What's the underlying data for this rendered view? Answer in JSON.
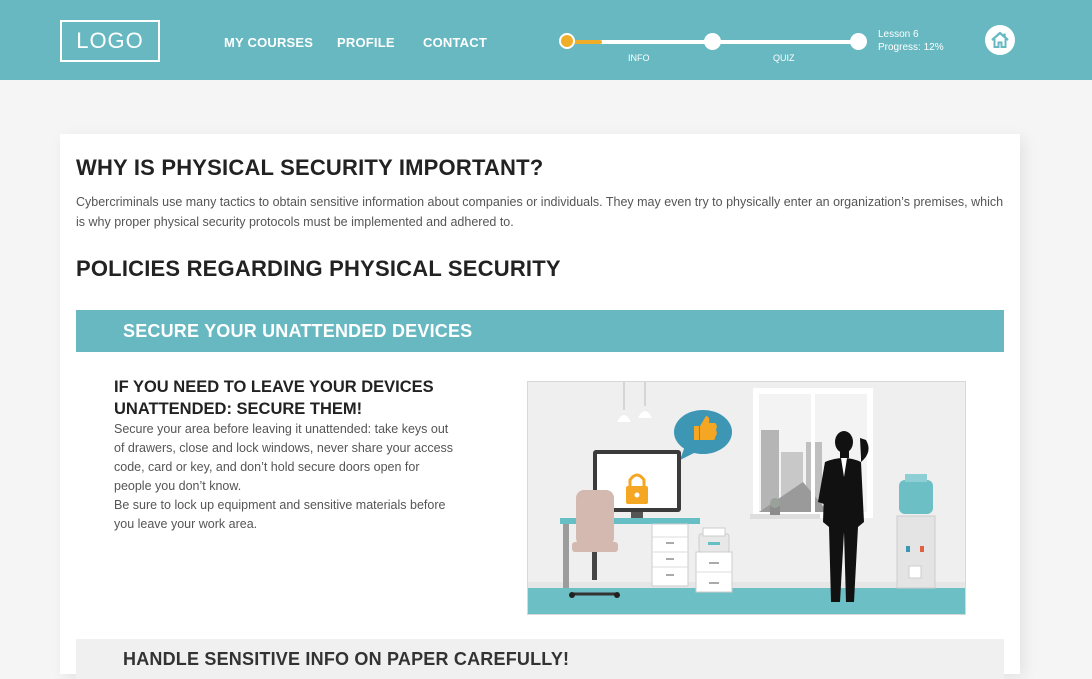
{
  "header": {
    "logo": "LOGO",
    "nav": [
      "MY COURSES",
      "PROFILE",
      "CONTACT"
    ],
    "progress": {
      "fraction": 0.12,
      "labels": [
        "INFO",
        "QUIZ"
      ],
      "lesson": "Lesson 6",
      "progress_text": "Progress: 12%"
    },
    "home_icon": "home-icon"
  },
  "content": {
    "title1": "WHY IS PHYSICAL SECURITY IMPORTANT?",
    "intro": "Cybercriminals use many tactics to obtain sensitive information about companies or individuals. They may even try to physically enter an organization’s premises, which is why proper physical security protocols must be implemented and adhered to.",
    "title2": "POLICIES REGARDING PHYSICAL SECURITY",
    "section1": {
      "banner": "SECURE YOUR UNATTENDED DEVICES",
      "heading": "IF YOU NEED TO LEAVE YOUR DEVICES UNATTENDED: SECURE THEM!",
      "paragraphs": [
        "Secure your area before leaving it unattended: take keys out of drawers, close and lock windows, never share your access code, card or key, and don’t hold secure doors open for people you don’t know.",
        "Be sure to lock up equipment and sensitive materials before you leave your work area."
      ]
    },
    "section2": {
      "banner": "HANDLE SENSITIVE INFO ON PAPER CAREFULLY!"
    }
  },
  "colors": {
    "accent": "#67b8c1",
    "progress": "#f0ad2a"
  }
}
